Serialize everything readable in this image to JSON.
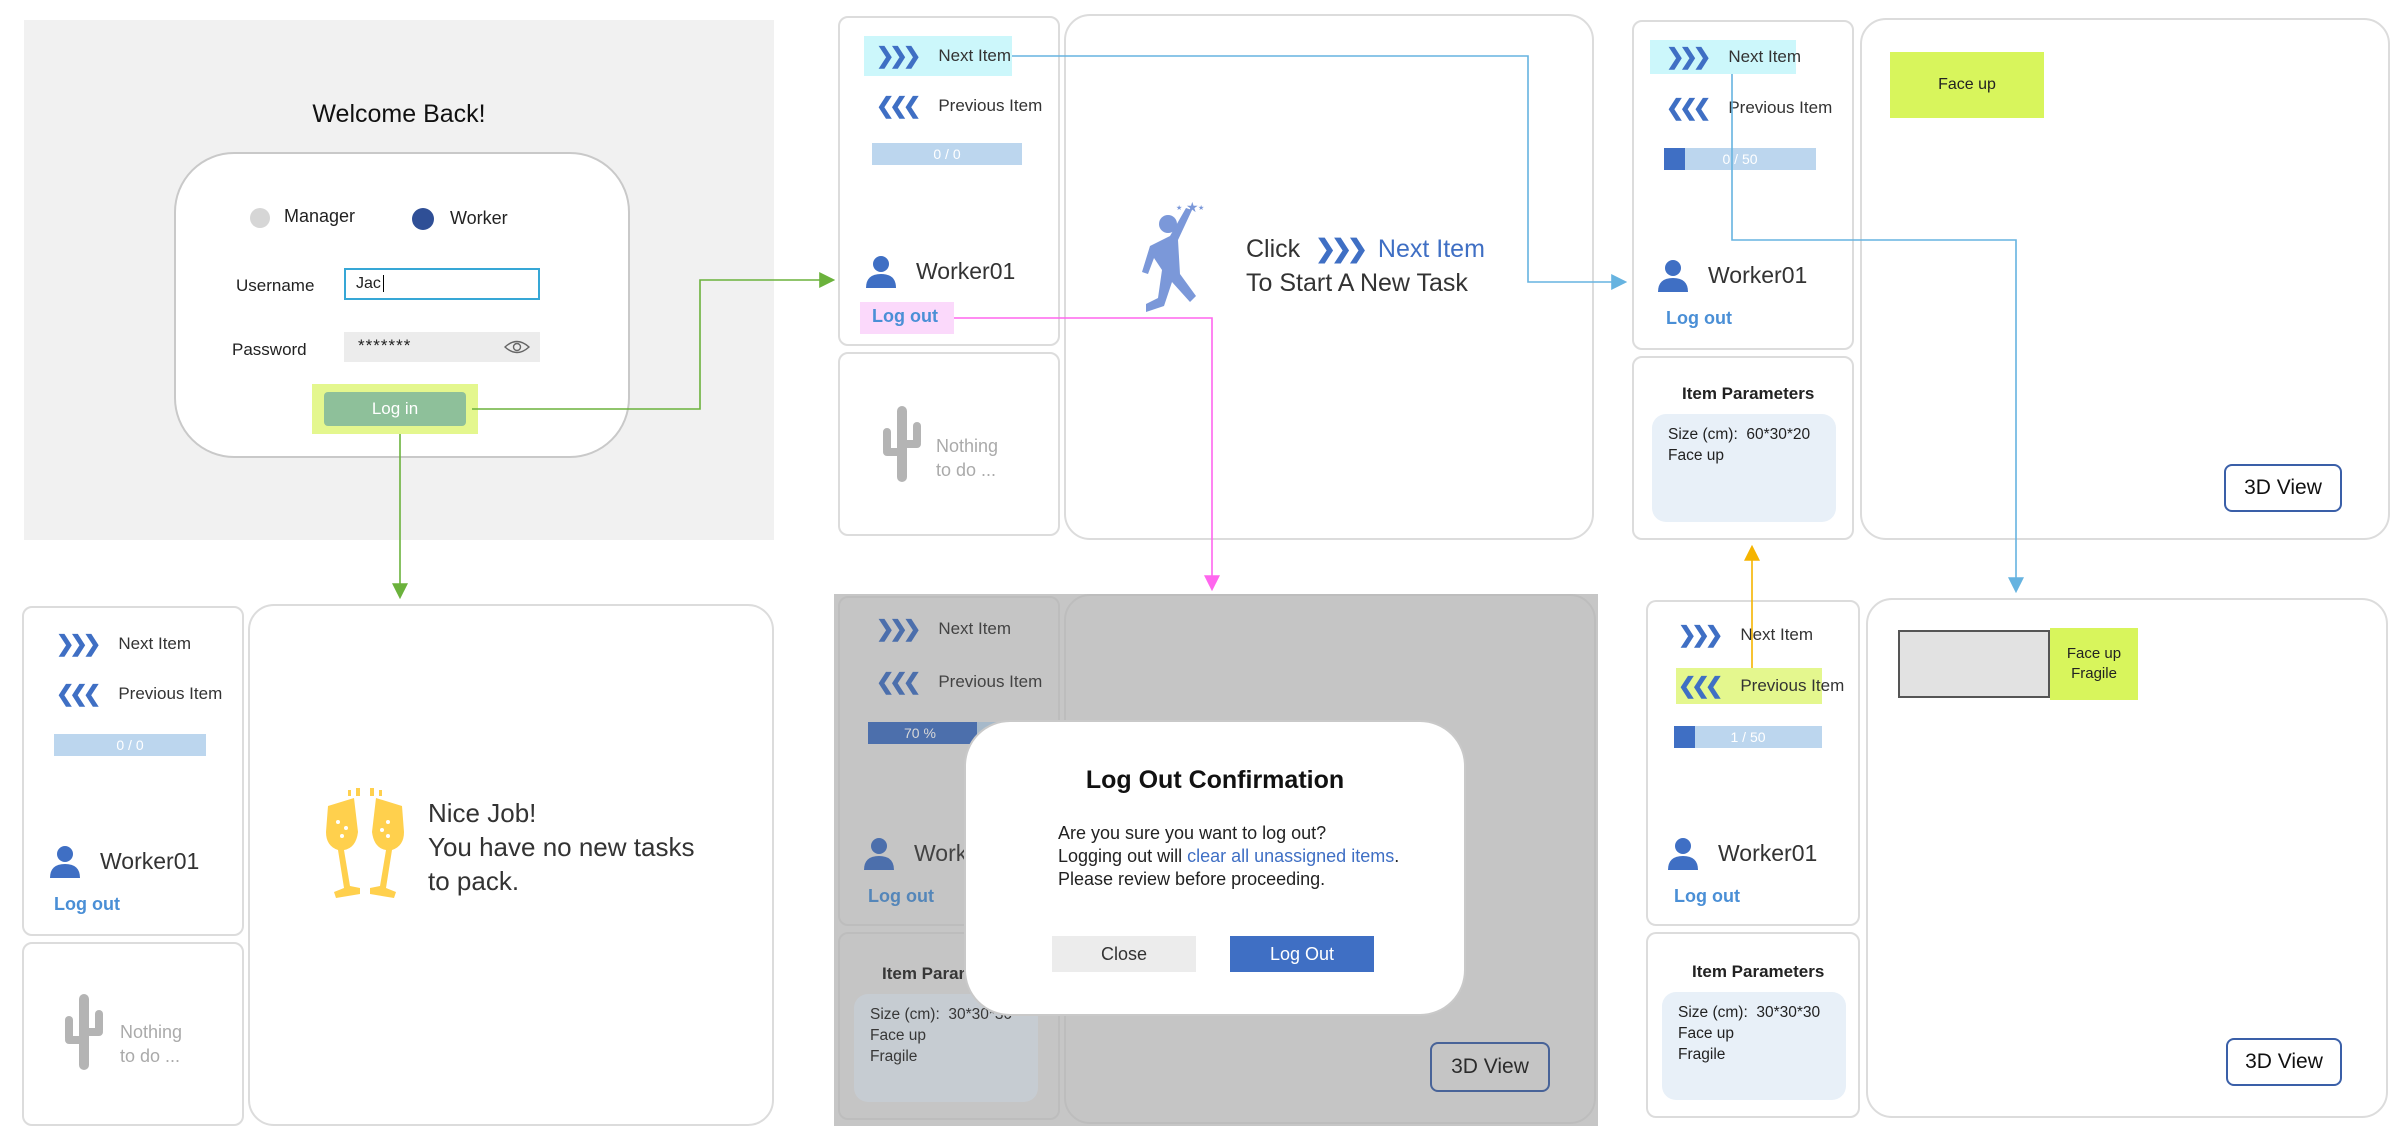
{
  "colors": {
    "accent": "#3f6fc4",
    "link": "#4a8fd6",
    "login_arrow": "#6bb23c",
    "logout_arrow": "#ff66ee",
    "next_arrow": "#66b3e0",
    "prev_arrow": "#f5b400",
    "highlight_cyan": "#ccf7fb",
    "highlight_pink": "#fbd9fb",
    "highlight_lime": "#e4f78e",
    "tag_lime": "#d8f55c"
  },
  "login": {
    "title": "Welcome Back!",
    "role_manager": "Manager",
    "role_worker": "Worker",
    "username_label": "Username",
    "username_value": "Jac",
    "password_label": "Password",
    "password_value": "*******",
    "eye_icon": "eye-icon",
    "login_button": "Log in"
  },
  "sidebar": {
    "next_item": "Next Item",
    "prev_item": "Previous Item",
    "next_icon": "double-chevron-right-icon",
    "prev_icon": "double-chevron-left-icon",
    "user_icon": "user-icon",
    "username": "Worker01",
    "logout": "Log out",
    "nothing": "Nothing",
    "todo": "to do ..."
  },
  "progress": {
    "a": {
      "label": "0 / 0",
      "fraction": 0
    },
    "b": {
      "label": "0 / 50",
      "fraction": 0.14
    },
    "c": {
      "label": "70 %",
      "fraction": 0.7
    },
    "d": {
      "label": "1 / 50",
      "fraction": 0.14
    }
  },
  "start_task": {
    "click": "Click",
    "next_item": "Next Item",
    "line2": "To Start A New Task"
  },
  "nice_job": {
    "line1": "Nice Job!",
    "line2": "You have no new tasks",
    "line3": "to pack."
  },
  "params": {
    "title": "Item Parameters",
    "b": {
      "size_label": "Size (cm):",
      "size_value": "60*30*20",
      "line2": "Face up"
    },
    "c": {
      "size_label": "Size (cm):",
      "size_value": "30*30*30",
      "line2": "Face up",
      "line3": "Fragile"
    },
    "d": {
      "size_label": "Size (cm):",
      "size_value": "30*30*30",
      "line2": "Face up",
      "line3": "Fragile"
    }
  },
  "view3d": "3D View",
  "tag_face_up": "Face up",
  "tag_face_up2": "Face up",
  "tag_fragile": "Fragile",
  "modal": {
    "title": "Log Out Confirmation",
    "line1": "Are you sure you want to log out?",
    "line2_pre": "Logging out will ",
    "line2_link": "clear all unassigned items",
    "line2_post": ".",
    "line3": "Please review before proceeding.",
    "close": "Close",
    "logout": "Log Out"
  }
}
